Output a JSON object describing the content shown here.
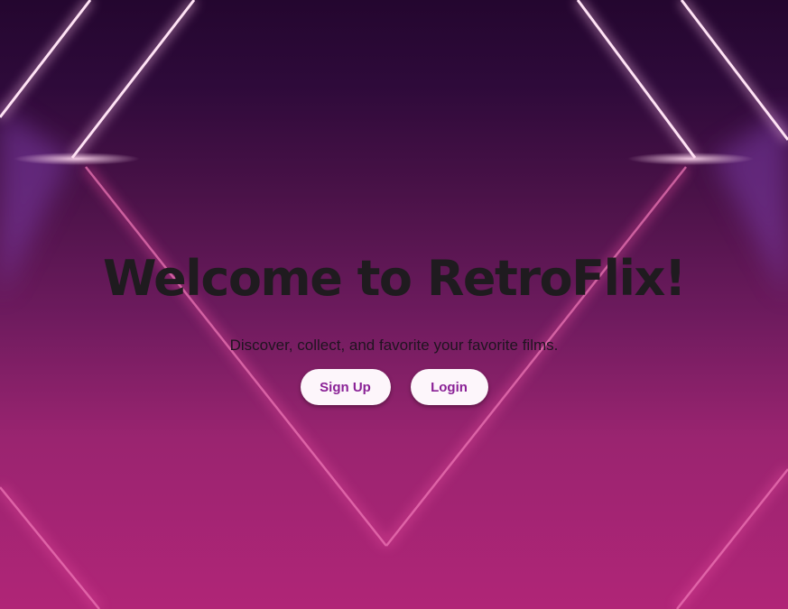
{
  "hero": {
    "title": "Welcome to RetroFlix!",
    "subtitle": "Discover, collect, and favorite your favorite films."
  },
  "actions": {
    "signup_label": "Sign Up",
    "login_label": "Login"
  },
  "colors": {
    "button_text": "#8a2196",
    "button_bg": "#fdf6fb",
    "title_text": "#1f1b1f",
    "bg_top": "#24062f",
    "bg_bottom": "#b02577",
    "neon": "#f7c6e6"
  }
}
